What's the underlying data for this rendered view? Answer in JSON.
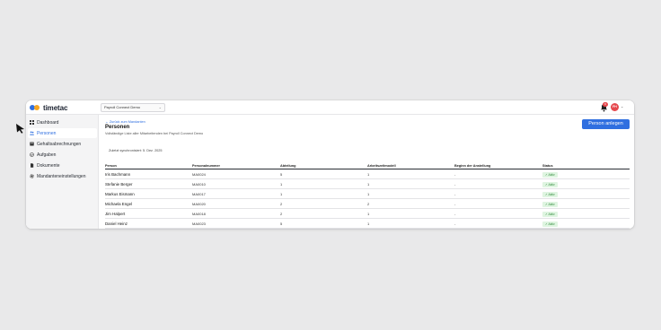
{
  "app": {
    "logo_text": "timetac",
    "mandant_select": "Payroll Connect Demo",
    "notification_count": "9",
    "avatar_initials": "FH"
  },
  "sidebar": {
    "items": [
      {
        "label": "Dashboard",
        "icon": "grid-icon"
      },
      {
        "label": "Personen",
        "icon": "people-icon"
      },
      {
        "label": "Gehaltsabrechnungen",
        "icon": "payslip-icon"
      },
      {
        "label": "Aufgaben",
        "icon": "check-circle-icon"
      },
      {
        "label": "Dokumente",
        "icon": "document-icon"
      },
      {
        "label": "Mandanteneinstellungen",
        "icon": "gear-icon"
      }
    ],
    "active_index": 1
  },
  "main": {
    "back_link": "← Zurück zum Mandanten",
    "title": "Personen",
    "subtitle": "Vollständige Liste aller Mitarbeitenden bei Payroll Connect Demo",
    "primary_button": "Person anlegen",
    "sync_text": "Zuletzt synchronisiert: 5. Dez. 2025"
  },
  "table": {
    "headers": [
      "Person",
      "Personalnummer",
      "Abteilung",
      "Arbeitszeitmodell",
      "Beginn der Anstellung",
      "Status"
    ],
    "rows": [
      [
        "Iris Bachmann",
        "MA0024",
        "5",
        "1",
        "-",
        "✓ Aktiv"
      ],
      [
        "Stefanie Berger",
        "MA0010",
        "1",
        "1",
        "-",
        "✓ Aktiv"
      ],
      [
        "Markus Eismann",
        "MA0017",
        "1",
        "1",
        "-",
        "✓ Aktiv"
      ],
      [
        "Michaela Engel",
        "MA0020",
        "2",
        "2",
        "-",
        "✓ Aktiv"
      ],
      [
        "Jim Halpert",
        "MA0018",
        "2",
        "1",
        "-",
        "✓ Aktiv"
      ],
      [
        "Daniel Heinz",
        "MA0023",
        "5",
        "1",
        "-",
        "✓ Aktiv"
      ]
    ]
  },
  "colors": {
    "accent": "#2f6fe0",
    "status_bg": "#dff5e1",
    "status_text": "#2f8a3a",
    "danger": "#e5484d"
  }
}
